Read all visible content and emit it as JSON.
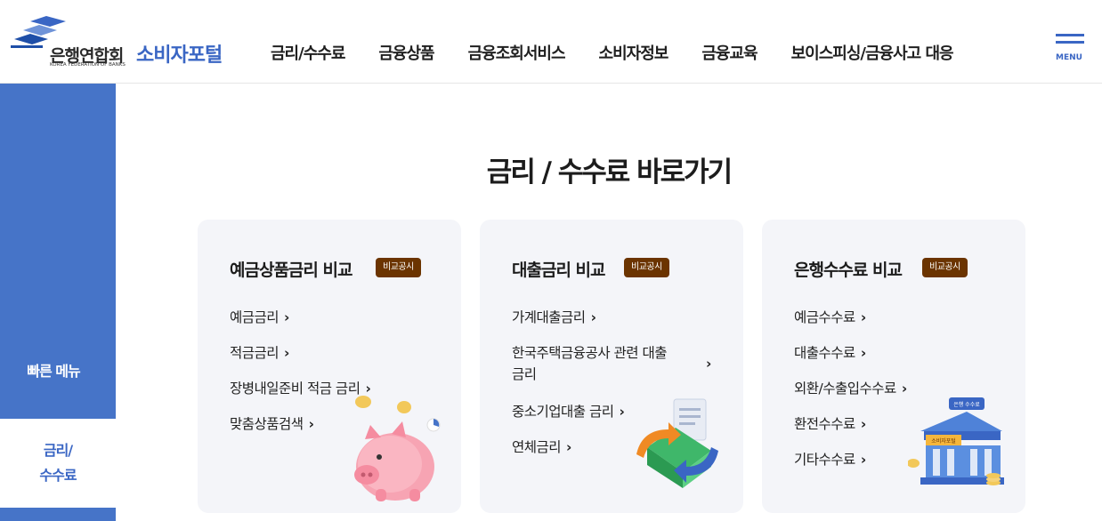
{
  "header": {
    "org_name": "은행연합회",
    "org_name_en": "KOREA FEDERATION OF BANKS",
    "portal_name": "소비자포털",
    "nav": [
      "금리/수수료",
      "금융상품",
      "금융조회서비스",
      "소비자정보",
      "금융교육",
      "보이스피싱/금융사고 대응"
    ],
    "menu_label": "MENU"
  },
  "side": {
    "title": "빠른 메뉴",
    "active_item": "금리/\n수수료"
  },
  "main": {
    "title": "금리 / 수수료 바로가기",
    "cards": [
      {
        "title": "예금상품금리 비교",
        "badge": "비교공시",
        "links": [
          "예금금리",
          "적금금리",
          "장병내일준비 적금 금리",
          "맞춤상품검색"
        ],
        "illustration": "piggy-bank-icon"
      },
      {
        "title": "대출금리 비교",
        "badge": "비교공시",
        "links": [
          "가계대출금리",
          "한국주택금융공사 관련 대출\n금리",
          "중소기업대출 금리",
          "연체금리"
        ],
        "illustration": "loan-exchange-icon"
      },
      {
        "title": "은행수수료 비교",
        "badge": "비교공시",
        "links": [
          "예금수수료",
          "대출수수료",
          "외환/수출입수수료",
          "환전수수료",
          "기타수수료"
        ],
        "illustration": "bank-building-icon",
        "illustration_sign": "은행 수수료",
        "illustration_banner": "소비자포털"
      }
    ]
  },
  "colors": {
    "brand_blue": "#3a66c4",
    "side_blue": "#4674c8",
    "badge_brown": "#6b3400",
    "card_bg": "#f4f5f9"
  }
}
